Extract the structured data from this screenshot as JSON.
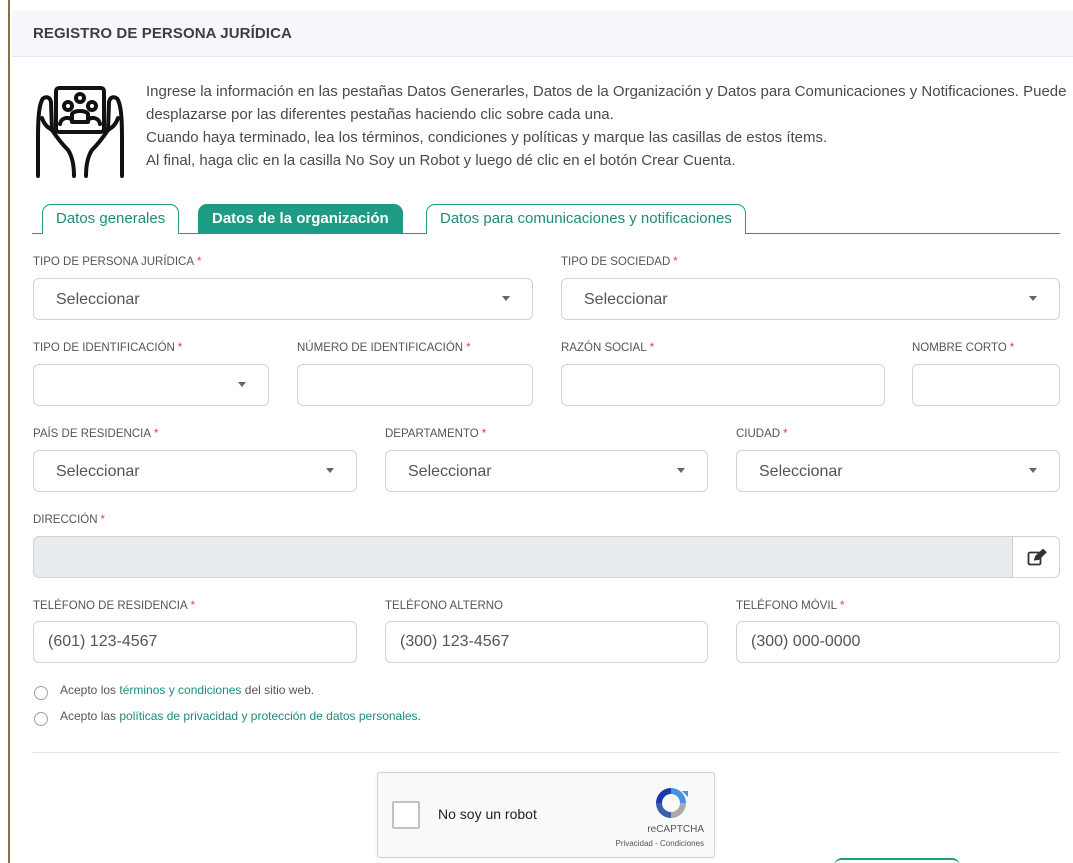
{
  "header": {
    "title": "REGISTRO DE PERSONA JURÍDICA"
  },
  "intro": {
    "icon": "hands-holding-group-icon",
    "line1": "Ingrese la información en las pestañas Datos Generarles, Datos de la Organización y Datos para Comunicaciones y Notificaciones. Puede desplazarse por las diferentes pestañas haciendo clic sobre cada una.",
    "line2": "Cuando haya terminado, lea los términos, condiciones y políticas y marque las casillas de estos ítems.",
    "line3": "Al final, haga clic en la casilla No Soy un Robot y luego dé clic en el botón Crear Cuenta."
  },
  "tabs": [
    {
      "label": "Datos generales",
      "active": false
    },
    {
      "label": "Datos de la organización",
      "active": true
    },
    {
      "label": "Datos para comunicaciones y notificaciones",
      "active": false
    }
  ],
  "form": {
    "required_mark": "*",
    "tipo_persona": {
      "label": "TIPO DE PERSONA JURÍDICA",
      "value": "Seleccionar"
    },
    "tipo_sociedad": {
      "label": "TIPO DE SOCIEDAD",
      "value": "Seleccionar"
    },
    "tipo_identificacion": {
      "label": "TIPO DE IDENTIFICACIÓN",
      "value": ""
    },
    "numero_identificacion": {
      "label": "NÚMERO DE IDENTIFICACIÓN",
      "value": ""
    },
    "razon_social": {
      "label": "RAZÓN SOCIAL",
      "value": ""
    },
    "nombre_corto": {
      "label": "NOMBRE CORTO",
      "value": ""
    },
    "pais": {
      "label": "PAÍS DE RESIDENCIA",
      "value": "Seleccionar"
    },
    "departamento": {
      "label": "DEPARTAMENTO",
      "value": "Seleccionar"
    },
    "ciudad": {
      "label": "CIUDAD",
      "value": "Seleccionar"
    },
    "direccion": {
      "label": "DIRECCIÓN",
      "value": "",
      "edit_icon": "edit-icon"
    },
    "telefono_residencia": {
      "label": "TELÉFONO DE RESIDENCIA",
      "placeholder": "(601) 123-4567"
    },
    "telefono_alterno": {
      "label": "TELÉFONO ALTERNO",
      "placeholder": "(300) 123-4567"
    },
    "telefono_movil": {
      "label": "TELÉFONO MÓVIL",
      "placeholder": "(300) 000-0000"
    }
  },
  "consents": {
    "terms": {
      "prefix": "Acepto los ",
      "link": "términos y condiciones",
      "suffix": " del sitio web."
    },
    "privacy": {
      "prefix": "Acepto las ",
      "link": "políticas de privacidad y protección de datos personales",
      "suffix": "."
    }
  },
  "captcha": {
    "label": "No soy un robot",
    "brand": "reCAPTCHA",
    "links": "Privacidad - Condiciones",
    "icon": "recaptcha-logo-icon"
  },
  "colors": {
    "accent": "#1d9b84",
    "required": "#e0473c",
    "disabled_bg": "#e9ecef"
  }
}
